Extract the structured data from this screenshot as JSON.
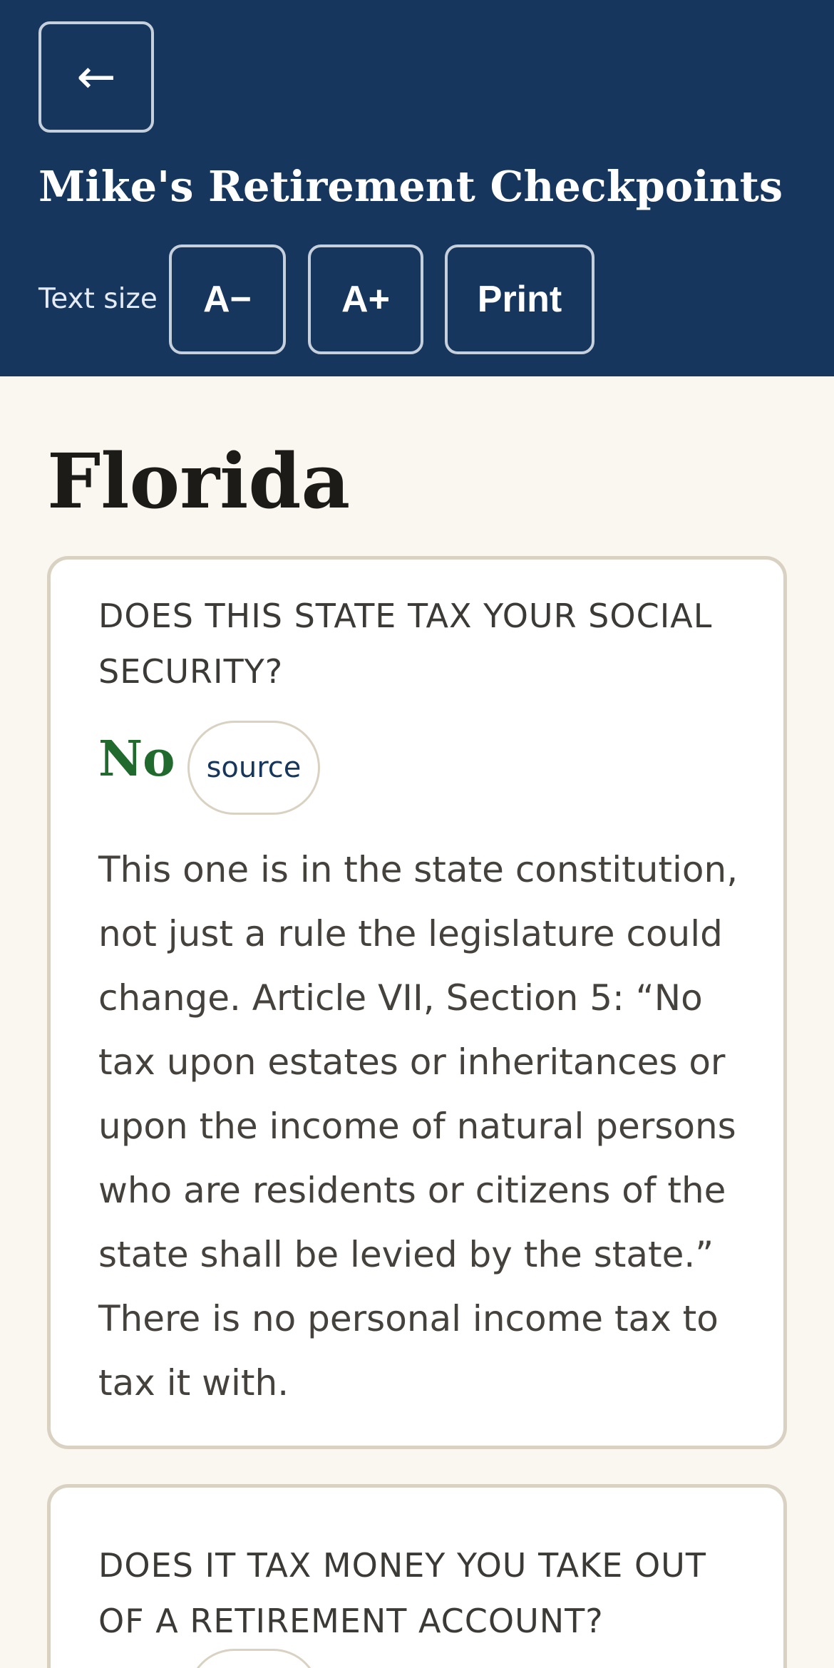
{
  "header": {
    "back_icon": "←",
    "app_title": "Mike's Retirement Checkpoints",
    "text_size_label": "Text size",
    "decrease_label": "A−",
    "increase_label": "A+",
    "print_label": "Print",
    "background_color": "#16365d"
  },
  "main": {
    "state_name": "Florida",
    "cards": [
      {
        "question": "DOES THIS STATE TAX YOUR SOCIAL SECURITY?",
        "answer": "No",
        "answer_color": "#1f6a2c",
        "source_label": "source",
        "explanation": "This one is in the state constitution, not just a rule the legislature could change. Article VII, Section 5: “No tax upon estates or inheritances or upon the income of natural persons who are residents or citizens of the state shall be levied by the state.” There is no personal income tax to tax it with."
      },
      {
        "question": "DOES IT TAX MONEY YOU TAKE OUT OF A RETIREMENT ACCOUNT?"
      }
    ]
  }
}
